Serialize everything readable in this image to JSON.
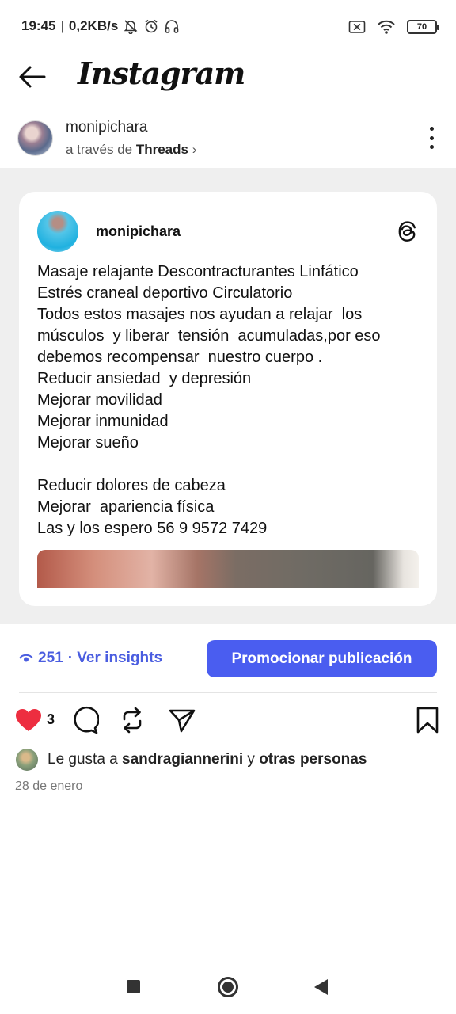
{
  "status_bar": {
    "time": "19:45",
    "network_speed": "0,2KB/s",
    "battery_level": "70",
    "icons": [
      "notifications-off-icon",
      "alarm-icon",
      "headphones-icon",
      "sim-off-icon",
      "wifi-icon",
      "battery-icon"
    ]
  },
  "header": {
    "app_name": "Instagram",
    "back_icon": "arrow-left-icon"
  },
  "post": {
    "author": "monipichara",
    "via_prefix": "a través de",
    "via_app": "Threads",
    "via_chevron": "›"
  },
  "threads_card": {
    "author": "monipichara",
    "text": "Masaje relajante Descontracturantes Linfático\nEstrés craneal deportivo Circulatorio\nTodos estos masajes nos ayudan a relajar  los músculos  y liberar  tensión  acumuladas,por eso debemos recompensar  nuestro cuerpo .\nReducir ansiedad  y depresión\nMejorar movilidad\nMejorar inmunidad\nMejorar sueño\n\nReducir dolores de cabeza\nMejorar  apariencia física\nLas y los espero 56 9 9572 7429"
  },
  "insights": {
    "count": "251",
    "link_text": "· Ver insights",
    "promote_label": "Promocionar publicación"
  },
  "actions": {
    "like_count": "3",
    "liked": true,
    "like_color": "#ed2e40"
  },
  "likes": {
    "prefix": "Le gusta a",
    "user": "sandragiannerini",
    "joiner": "y",
    "others": "otras personas"
  },
  "date": "28 de enero",
  "colors": {
    "accent": "#4a5df0",
    "link": "#4a5de0",
    "media_background": "#efefef"
  }
}
